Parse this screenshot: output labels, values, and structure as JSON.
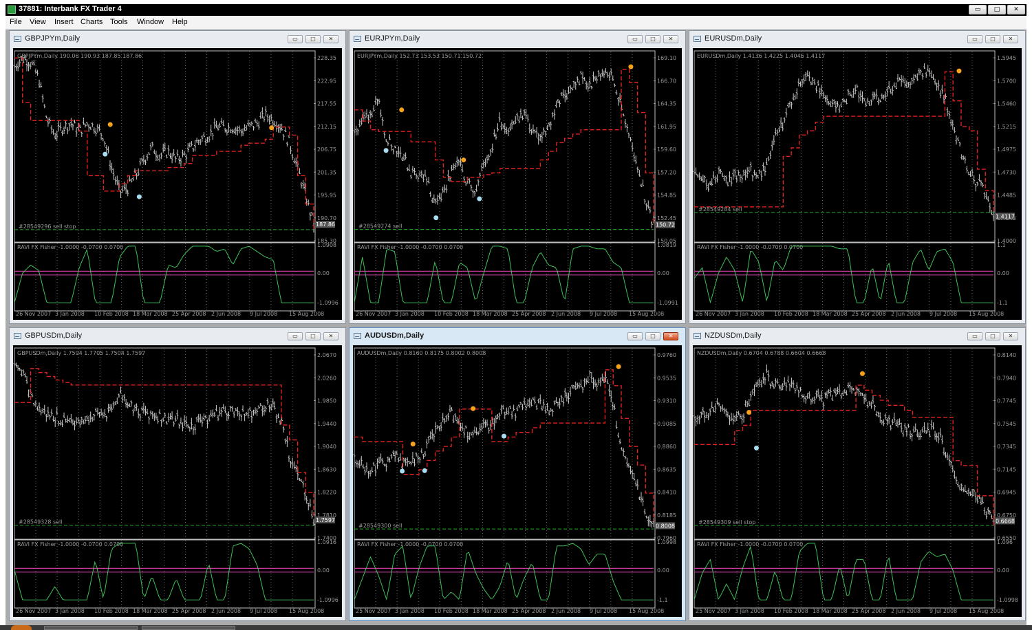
{
  "app": {
    "title": "37881: Interbank FX Trader 4",
    "icon": "metatrader-app-icon",
    "window_controls": [
      "minimize-button",
      "restore-button",
      "close-button"
    ]
  },
  "menu": [
    "File",
    "View",
    "Insert",
    "Charts",
    "Tools",
    "Window",
    "Help"
  ],
  "window_button_glyphs": {
    "minimize": "▭",
    "maximize": "□",
    "close": "✕"
  },
  "colors": {
    "chart_bg": "#000000",
    "bars": "#c8c8c8",
    "stop_line": "#e0211f",
    "sell_dots": "#f7a21b",
    "buy_dots": "#a8dcf0",
    "order_line": "#1fae2a",
    "indicator_line": "#3fbf5a",
    "zero_line": "#c43ca0",
    "price_label_bg": "#555555"
  },
  "x_dates": [
    "26 Nov 2007",
    "3 Jan 2008",
    "10 Feb 2008",
    "18 Mar 2008",
    "25 Apr 2008",
    "2 Jun 2008",
    "9 Jul 2008",
    "15 Aug 2008"
  ],
  "x_dates_alt": [
    "25 Nov 2007",
    "3 Jan 2008",
    "10 Feb 2008",
    "18 Mar 2008",
    "25 Apr 2008",
    "2 Jun 2008",
    "9 Jul 2008",
    "15 Aug 2008"
  ],
  "charts": [
    {
      "window_title": "GBPJPYm,Daily",
      "header": "GBPJPYm,Daily  190.06 190.93 187.85 187.86",
      "price_ticks": [
        "228.35",
        "222.95",
        "217.55",
        "212.15",
        "206.75",
        "201.35",
        "195.95",
        "190.70",
        "185.30"
      ],
      "last_price": "187.86",
      "order_label": "#28549296 sell stop",
      "indicator_header": "RAVI FX Fisher -1.0000 -0.0700 0.0700",
      "ind_ticks": [
        "1.0908",
        "0.00",
        "-1.0996"
      ],
      "date_set": "main",
      "active": false,
      "chart_data": {
        "type": "line",
        "ylim": [
          184.3,
          229.4
        ],
        "close_knots": [
          227,
          229,
          228,
          224,
          214,
          210,
          212,
          213,
          211,
          213,
          212,
          210,
          202,
          196,
          197,
          200,
          204,
          207,
          205,
          206,
          204,
          205,
          207,
          209,
          210,
          212,
          212,
          212,
          211,
          212,
          213,
          215,
          214,
          212,
          208,
          202,
          195,
          188
        ],
        "stop_knots": [
          229.0,
          218.0,
          213.6,
          213.6,
          213.6,
          213.6,
          213.6,
          213.6,
          211.0,
          200.0,
          200.0,
          196.2,
          196.2,
          198.0,
          200.0,
          201.2,
          201.2,
          201.2,
          201.2,
          202.0,
          202.0,
          203.0,
          205.0,
          205.0,
          205.0,
          206.0,
          206.0,
          206.0,
          207.5,
          208.0,
          208.0,
          209.0,
          212.0,
          212.0,
          210.0,
          200.0,
          193.0,
          186.7
        ],
        "order_price": 186.7,
        "sell_dots": [
          {
            "t": 0.32,
            "v": 212.6
          },
          {
            "t": 0.859,
            "v": 211.8
          }
        ],
        "buy_dots": [
          {
            "t": 0.303,
            "v": 205.3
          },
          {
            "t": 0.417,
            "v": 194.8
          }
        ],
        "ind_knots": [
          -1.1,
          0.0,
          0.3,
          0.1,
          -1.1,
          -1.1,
          -1.1,
          -1.1,
          0.2,
          0.9,
          -1.1,
          -1.1,
          -1.1,
          0.6,
          1.0,
          1.0,
          -1.1,
          -1.1,
          -1.1,
          0.3,
          0.2,
          0.7,
          1.0,
          1.0,
          1.0,
          0.8,
          0.9,
          0.3,
          0.9,
          1.0,
          0.8,
          0.6,
          0.5,
          -1.1,
          -1.1,
          -1.1,
          -1.1,
          -1.1
        ],
        "ind_range": [
          -1.3,
          1.1
        ]
      }
    },
    {
      "window_title": "EURJPYm,Daily",
      "header": "EURJPYm,Daily  152.73 153.53 150.71 150.72",
      "price_ticks": [
        "169.10",
        "166.70",
        "164.35",
        "161.95",
        "159.60",
        "157.20",
        "154.85",
        "152.45",
        "150.05"
      ],
      "last_price": "150.72",
      "order_label": "#28549274 sell",
      "indicator_header": "RAVI FX Fisher -1.0000 -0.0700 0.0700",
      "ind_ticks": [
        "1.0819",
        "0.00",
        "-1.0991"
      ],
      "date_set": "main",
      "active": false,
      "chart_data": {
        "type": "line",
        "ylim": [
          149.3,
          170.5
        ],
        "close_knots": [
          162,
          163,
          164,
          165,
          161,
          160,
          159,
          157,
          157,
          156,
          153,
          155,
          157,
          158,
          156,
          155,
          158,
          160,
          163,
          162,
          163,
          164,
          162,
          161,
          162,
          165,
          166,
          167,
          168,
          167,
          168,
          169,
          168,
          165,
          161,
          158,
          154,
          151
        ],
        "stop_knots": [
          164.3,
          163.0,
          162.0,
          161.8,
          161.8,
          161.8,
          161.8,
          160.6,
          160.6,
          160.6,
          158.5,
          156.5,
          156.0,
          156.0,
          156.5,
          156.5,
          156.8,
          157.0,
          157.5,
          157.5,
          157.5,
          157.5,
          157.5,
          158.5,
          159.5,
          160.5,
          161.0,
          161.5,
          162.0,
          162.0,
          162.0,
          162.0,
          162.0,
          169.0,
          167.5,
          164.0,
          157.0,
          151.0
        ],
        "order_price": 150.45,
        "sell_dots": [
          {
            "t": 0.158,
            "v": 164.3
          },
          {
            "t": 0.365,
            "v": 158.5
          },
          {
            "t": 0.924,
            "v": 169.3
          }
        ],
        "buy_dots": [
          {
            "t": 0.106,
            "v": 159.6
          },
          {
            "t": 0.273,
            "v": 151.8
          },
          {
            "t": 0.418,
            "v": 154.0
          }
        ],
        "ind_knots": [
          -1.1,
          0.6,
          -1.1,
          -1.1,
          0.9,
          0.8,
          -1.1,
          -1.1,
          -1.1,
          -1.1,
          0.5,
          -1.1,
          -1.1,
          0.4,
          0.2,
          -1.1,
          0.0,
          1.0,
          1.0,
          0.9,
          -1.1,
          -1.1,
          0.2,
          0.8,
          0.3,
          0.2,
          -1.1,
          0.9,
          1.0,
          1.0,
          0.9,
          0.9,
          0.4,
          0.2,
          -1.1,
          -1.1,
          -1.1,
          -1.1
        ],
        "ind_range": [
          -1.3,
          1.1
        ]
      }
    },
    {
      "window_title": "EURUSDm,Daily",
      "header": "EURUSDm,Daily  1.4136 1.4225 1.4046 1.4117",
      "price_ticks": [
        "1.5945",
        "1.5700",
        "1.5460",
        "1.5215",
        "1.4975",
        "1.4730",
        "1.4485",
        "1.4245",
        "1.4000"
      ],
      "last_price": "1.4117",
      "order_label": "#28549284 sell",
      "indicator_header": "RAVI FX Fisher -1.0000 -0.0700 0.0700",
      "ind_ticks": [
        "1.1",
        "0.00",
        "-1.1"
      ],
      "date_set": "main",
      "active": false,
      "chart_data": {
        "type": "line",
        "ylim": [
          1.393,
          1.607
        ],
        "close_knots": [
          1.475,
          1.465,
          1.455,
          1.47,
          1.462,
          1.468,
          1.47,
          1.475,
          1.465,
          1.48,
          1.51,
          1.53,
          1.555,
          1.575,
          1.585,
          1.575,
          1.56,
          1.555,
          1.545,
          1.56,
          1.57,
          1.555,
          1.555,
          1.56,
          1.57,
          1.575,
          1.575,
          1.58,
          1.59,
          1.585,
          1.575,
          1.56,
          1.525,
          1.495,
          1.47,
          1.46,
          1.45,
          1.42
        ],
        "stop_knots": [
          1.431,
          1.431,
          1.431,
          1.431,
          1.431,
          1.431,
          1.431,
          1.431,
          1.431,
          1.431,
          1.431,
          1.49,
          1.5,
          1.515,
          1.52,
          1.53,
          1.537,
          1.537,
          1.537,
          1.537,
          1.537,
          1.537,
          1.537,
          1.537,
          1.537,
          1.537,
          1.537,
          1.537,
          1.537,
          1.537,
          1.537,
          1.589,
          1.555,
          1.525,
          1.52,
          1.475,
          1.45,
          1.425
        ],
        "order_price": 1.4245,
        "sell_dots": [
          {
            "t": 0.885,
            "v": 1.59
          }
        ],
        "buy_dots": [],
        "ind_knots": [
          -0.2,
          0.2,
          -1.1,
          0.0,
          0.6,
          0.1,
          -1.1,
          0.9,
          0.4,
          -1.1,
          0.5,
          0.1,
          1.0,
          1.0,
          1.0,
          1.0,
          1.0,
          1.0,
          0.9,
          0.9,
          -1.1,
          -1.1,
          0.3,
          -1.1,
          0.5,
          -1.1,
          -1.1,
          0.4,
          0.9,
          0.1,
          0.8,
          0.9,
          0.4,
          -1.1,
          -1.1,
          -1.1,
          -1.1,
          -1.1
        ],
        "ind_range": [
          -1.3,
          1.1
        ]
      }
    },
    {
      "window_title": "GBPUSDm,Daily",
      "header": "GBPUSDm,Daily  1.7594 1.7705 1.7504 1.7597",
      "price_ticks": [
        "2.0670",
        "2.0260",
        "1.9850",
        "1.9440",
        "1.9040",
        "1.8630",
        "1.8220",
        "1.7810",
        "1.7400"
      ],
      "last_price": "1.7597",
      "order_label": "#28549328 sell",
      "indicator_header": "RAVI FX Fisher -1.0000 -0.0700 0.0700",
      "ind_ticks": [
        "1.0916",
        "0.00",
        "-1.0996"
      ],
      "date_set": "main",
      "active": false,
      "chart_data": {
        "type": "line",
        "ylim": [
          1.732,
          2.098
        ],
        "close_knots": [
          2.085,
          2.06,
          2.01,
          1.985,
          1.975,
          1.97,
          1.965,
          1.965,
          1.955,
          1.965,
          1.975,
          1.975,
          1.985,
          2.015,
          2.0,
          1.985,
          1.98,
          1.975,
          1.97,
          1.965,
          1.97,
          1.96,
          1.95,
          1.965,
          1.97,
          1.975,
          1.98,
          1.985,
          1.985,
          1.975,
          1.99,
          1.995,
          1.99,
          1.96,
          1.895,
          1.855,
          1.82,
          1.765
        ],
        "stop_knots": [
          2.0,
          2.0,
          2.068,
          2.06,
          2.052,
          2.045,
          2.04,
          2.035,
          2.035,
          2.035,
          2.035,
          2.035,
          2.035,
          2.035,
          2.035,
          2.035,
          2.035,
          2.035,
          2.035,
          2.035,
          2.035,
          2.035,
          2.035,
          2.035,
          2.035,
          2.035,
          2.035,
          2.035,
          2.035,
          2.035,
          2.035,
          2.035,
          2.035,
          1.955,
          1.925,
          1.86,
          1.82,
          1.77
        ],
        "order_price": 1.7545,
        "sell_dots": [],
        "buy_dots": [],
        "ind_knots": [
          0.0,
          -1.1,
          -1.1,
          -1.1,
          -1.1,
          -0.6,
          -1.1,
          -1.1,
          -1.1,
          -1.1,
          0.4,
          -1.1,
          0.8,
          1.0,
          1.0,
          1.0,
          -1.1,
          -0.2,
          -1.1,
          -1.1,
          -0.3,
          -1.1,
          -1.1,
          -1.1,
          0.3,
          -1.1,
          -1.1,
          0.9,
          1.0,
          0.8,
          0.2,
          -1.1,
          -1.1,
          -1.1,
          -1.1,
          -1.1,
          -1.1,
          -1.1
        ],
        "ind_range": [
          -1.3,
          1.1
        ]
      }
    },
    {
      "window_title": "AUDUSDm,Daily",
      "header": "AUDUSDm,Daily  0.8160 0.8175 0.8002 0.8008",
      "price_ticks": [
        "0.9760",
        "0.9535",
        "0.9310",
        "0.9085",
        "0.8860",
        "0.8635",
        "0.8410",
        "0.8185",
        "0.7960"
      ],
      "last_price": "0.8008",
      "order_label": "#28549300 sell",
      "indicator_header": "RAVI FX Fisher -1.0000 -0.0700 0.0700",
      "ind_ticks": [
        "1.0998",
        "0.00",
        "-1.1"
      ],
      "date_set": "alt",
      "active": true,
      "chart_data": {
        "type": "line",
        "ylim": [
          0.7935,
          0.9895
        ],
        "close_knots": [
          0.875,
          0.87,
          0.865,
          0.87,
          0.875,
          0.88,
          0.87,
          0.875,
          0.88,
          0.89,
          0.905,
          0.915,
          0.925,
          0.915,
          0.905,
          0.9,
          0.91,
          0.915,
          0.925,
          0.93,
          0.925,
          0.935,
          0.94,
          0.935,
          0.93,
          0.935,
          0.945,
          0.95,
          0.955,
          0.965,
          0.96,
          0.965,
          0.935,
          0.885,
          0.865,
          0.845,
          0.82,
          0.805
        ],
        "stop_knots": [
          0.9,
          0.895,
          0.895,
          0.895,
          0.895,
          0.895,
          0.86,
          0.86,
          0.865,
          0.875,
          0.885,
          0.89,
          0.9,
          0.93,
          0.93,
          0.93,
          0.93,
          0.895,
          0.895,
          0.9,
          0.905,
          0.905,
          0.91,
          0.915,
          0.915,
          0.915,
          0.915,
          0.915,
          0.915,
          0.915,
          0.915,
          0.972,
          0.955,
          0.92,
          0.89,
          0.87,
          0.84,
          0.81
        ],
        "order_price": 0.8015,
        "sell_dots": [
          {
            "t": 0.196,
            "v": 0.8925
          },
          {
            "t": 0.397,
            "v": 0.9305
          },
          {
            "t": 0.883,
            "v": 0.9755
          }
        ],
        "buy_dots": [
          {
            "t": 0.16,
            "v": 0.8635
          },
          {
            "t": 0.235,
            "v": 0.864
          },
          {
            "t": 0.5,
            "v": 0.901
          }
        ],
        "ind_knots": [
          -1.1,
          -0.3,
          0.5,
          -0.2,
          -1.1,
          0.6,
          0.9,
          -1.1,
          0.1,
          0.9,
          0.9,
          -1.1,
          -0.8,
          -1.1,
          0.8,
          -0.1,
          -0.7,
          -1.1,
          -0.6,
          0.4,
          -1.1,
          -0.3,
          0.3,
          -1.1,
          -1.1,
          0.9,
          0.9,
          1.0,
          0.8,
          0.2,
          0.6,
          0.6,
          -0.4,
          -1.1,
          -1.1,
          -1.1,
          -1.1,
          -1.1
        ],
        "ind_range": [
          -1.3,
          1.1
        ]
      }
    },
    {
      "window_title": "NZDUSDm,Daily",
      "header": "NZDUSDm,Daily  0.6704 0.6788 0.6604 0.6668",
      "price_ticks": [
        "0.8140",
        "0.7940",
        "0.7745",
        "0.7545",
        "0.7345",
        "0.7145",
        "0.6945",
        "0.6750",
        "0.6550"
      ],
      "last_price": "0.6668",
      "order_label": "#28549309 sell stop",
      "indicator_header": "RAVI FX Fisher -1.0000 -0.0700 0.0700",
      "ind_ticks": [
        "1.096",
        "0.00",
        "-1.0998"
      ],
      "date_set": "alt",
      "active": false,
      "chart_data": {
        "type": "line",
        "ylim": [
          0.6495,
          0.8315
        ],
        "close_knots": [
          0.765,
          0.77,
          0.775,
          0.78,
          0.772,
          0.765,
          0.77,
          0.785,
          0.8,
          0.81,
          0.8,
          0.8,
          0.805,
          0.795,
          0.785,
          0.79,
          0.785,
          0.79,
          0.79,
          0.795,
          0.795,
          0.785,
          0.78,
          0.77,
          0.765,
          0.76,
          0.755,
          0.755,
          0.755,
          0.755,
          0.755,
          0.735,
          0.715,
          0.7,
          0.695,
          0.69,
          0.675,
          0.665
        ],
        "stop_knots": [
          0.741,
          0.741,
          0.741,
          0.741,
          0.741,
          0.755,
          0.76,
          0.775,
          0.775,
          0.775,
          0.775,
          0.775,
          0.775,
          0.775,
          0.775,
          0.775,
          0.775,
          0.775,
          0.775,
          0.775,
          0.8,
          0.795,
          0.79,
          0.785,
          0.78,
          0.78,
          0.775,
          0.768,
          0.768,
          0.768,
          0.768,
          0.768,
          0.725,
          0.72,
          0.72,
          0.69,
          0.69,
          0.66
        ],
        "order_price": 0.6605,
        "sell_dots": [
          {
            "t": 0.183,
            "v": 0.773
          },
          {
            "t": 0.562,
            "v": 0.8115
          }
        ],
        "buy_dots": [
          {
            "t": 0.208,
            "v": 0.7375
          }
        ],
        "ind_knots": [
          -1.1,
          -0.1,
          0.4,
          -1.1,
          -0.5,
          -1.1,
          0.1,
          0.9,
          -1.1,
          -1.1,
          0.0,
          -1.1,
          -1.1,
          0.7,
          1.0,
          1.0,
          -1.1,
          -1.1,
          0.2,
          -1.1,
          0.4,
          0.4,
          -1.1,
          -1.1,
          0.6,
          -1.1,
          -1.1,
          -1.1,
          0.3,
          0.7,
          0.5,
          0.6,
          0.0,
          -1.1,
          -1.1,
          -1.1,
          -1.1,
          -1.1
        ],
        "ind_range": [
          -1.3,
          1.1
        ]
      }
    }
  ]
}
